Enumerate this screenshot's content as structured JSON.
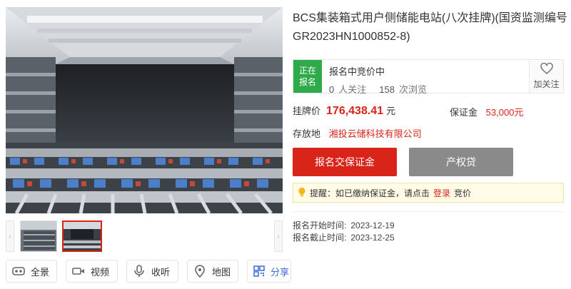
{
  "listing": {
    "title": "BCS集装箱式用户侧储能电站(八次挂牌)(国资监测编号GR2023HN1000852-8)"
  },
  "status": {
    "tag_line1": "正在",
    "tag_line2": "报名",
    "phase": "报名中竞价中",
    "followers_count": "0",
    "followers_label": "人关注",
    "views_count": "158",
    "views_label": "次浏览",
    "follow_label": "加关注",
    "tag_color": "#2eaa4a"
  },
  "price": {
    "label": "挂牌价",
    "value": "176,438.41",
    "unit": "元",
    "deposit_label": "保证金",
    "deposit_value": "53,000元",
    "accent_color": "#d9241a"
  },
  "location": {
    "label": "存放地",
    "value": "湘投云储科技有限公司"
  },
  "actions": {
    "primary_label": "报名交保证金",
    "secondary_label": "产权贷"
  },
  "tip": {
    "prefix": "提醒：如已缴纳保证金，请点击",
    "login_label": "登录",
    "suffix": "竞价",
    "icon": "lightbulb-icon"
  },
  "dates": {
    "start_label": "报名开始时间:",
    "start_value": "2023-12-19",
    "end_label": "报名截止时间:",
    "end_value": "2023-12-25"
  },
  "gallery": {
    "thumbnails": [
      "thumbnail-1",
      "thumbnail-2"
    ],
    "selected_index": 1
  },
  "tools": [
    {
      "label": "全景",
      "icon": "vr-icon"
    },
    {
      "label": "视频",
      "icon": "video-icon"
    },
    {
      "label": "收听",
      "icon": "microphone-icon"
    },
    {
      "label": "地图",
      "icon": "map-pin-icon"
    },
    {
      "label": "分享",
      "icon": "qrcode-icon"
    }
  ]
}
